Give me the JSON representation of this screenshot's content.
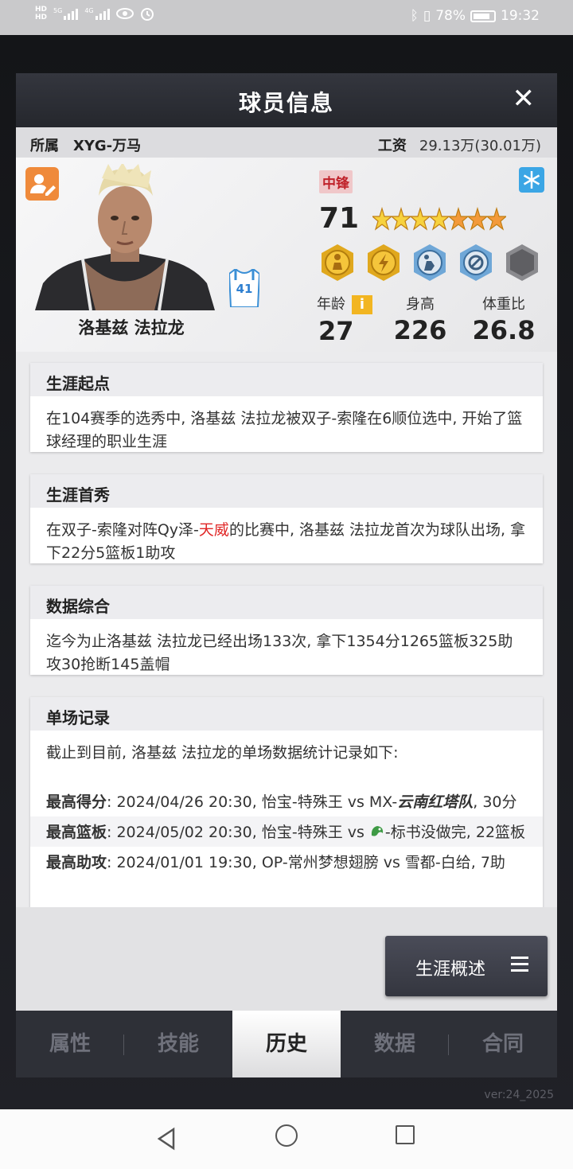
{
  "status": {
    "hd1": "HD",
    "hd2": "HD",
    "sig1": "5G",
    "sig2": "4G",
    "battery": "78%",
    "time": "19:32"
  },
  "bg": {
    "version": "ver:24_2025"
  },
  "dialog": {
    "title": "球员信息",
    "close": "✕"
  },
  "info": {
    "team_label": "所属",
    "team": "XYG-万马",
    "salary_label": "工资",
    "salary": "29.13万(30.01万)"
  },
  "player": {
    "name": "洛基兹 法拉龙",
    "jersey": "41",
    "position": "中锋",
    "rating": "71",
    "stars": 6.5,
    "age_label": "年龄",
    "age": "27",
    "height_label": "身高",
    "height": "226",
    "ratio_label": "体重比",
    "ratio": "26.8",
    "info_icon": "i"
  },
  "history": {
    "start_title": "生涯起点",
    "start_text": "在104赛季的选秀中, 洛基兹 法拉龙被双子-索隆在6顺位选中, 开始了篮球经理的职业生涯",
    "debut_title": "生涯首秀",
    "debut_pre": "在双子-索隆对阵Qy泽-",
    "debut_red": "天威",
    "debut_post": "的比赛中, 洛基兹 法拉龙首次为球队出场, 拿下22分5篮板1助攻",
    "summary_title": "数据综合",
    "summary_text": "迄今为止洛基兹 法拉龙已经出场133次, 拿下1354分1265篮板325助攻30抢断145盖帽",
    "records_title": "单场记录",
    "records_intro": "截止到目前, 洛基兹 法拉龙的单场数据统计记录如下:",
    "rec1_label": "最高得分",
    "rec1_pre": ": 2024/04/26 20:30, 怡宝-特殊王 vs MX-",
    "rec1_team": "云南红塔队",
    "rec1_post": ", 30分",
    "rec2_label": "最高篮板",
    "rec2_pre": ": 2024/05/02 20:30, 怡宝-特殊王 vs ",
    "rec2_post": "-标书没做完, 22篮板",
    "rec3_label": "最高助攻",
    "rec3_text": ": 2024/01/01 19:30, OP-常州梦想翅膀 vs 雪都-白给, 7助"
  },
  "career_button": "生涯概述",
  "tabs": [
    "属性",
    "技能",
    "历史",
    "数据",
    "合同"
  ],
  "active_tab": "历史",
  "colors": {
    "accent": "#ef8a3b",
    "position_red": "#c0232b",
    "highlight_red": "#e02525",
    "dark": "#2e3037"
  }
}
